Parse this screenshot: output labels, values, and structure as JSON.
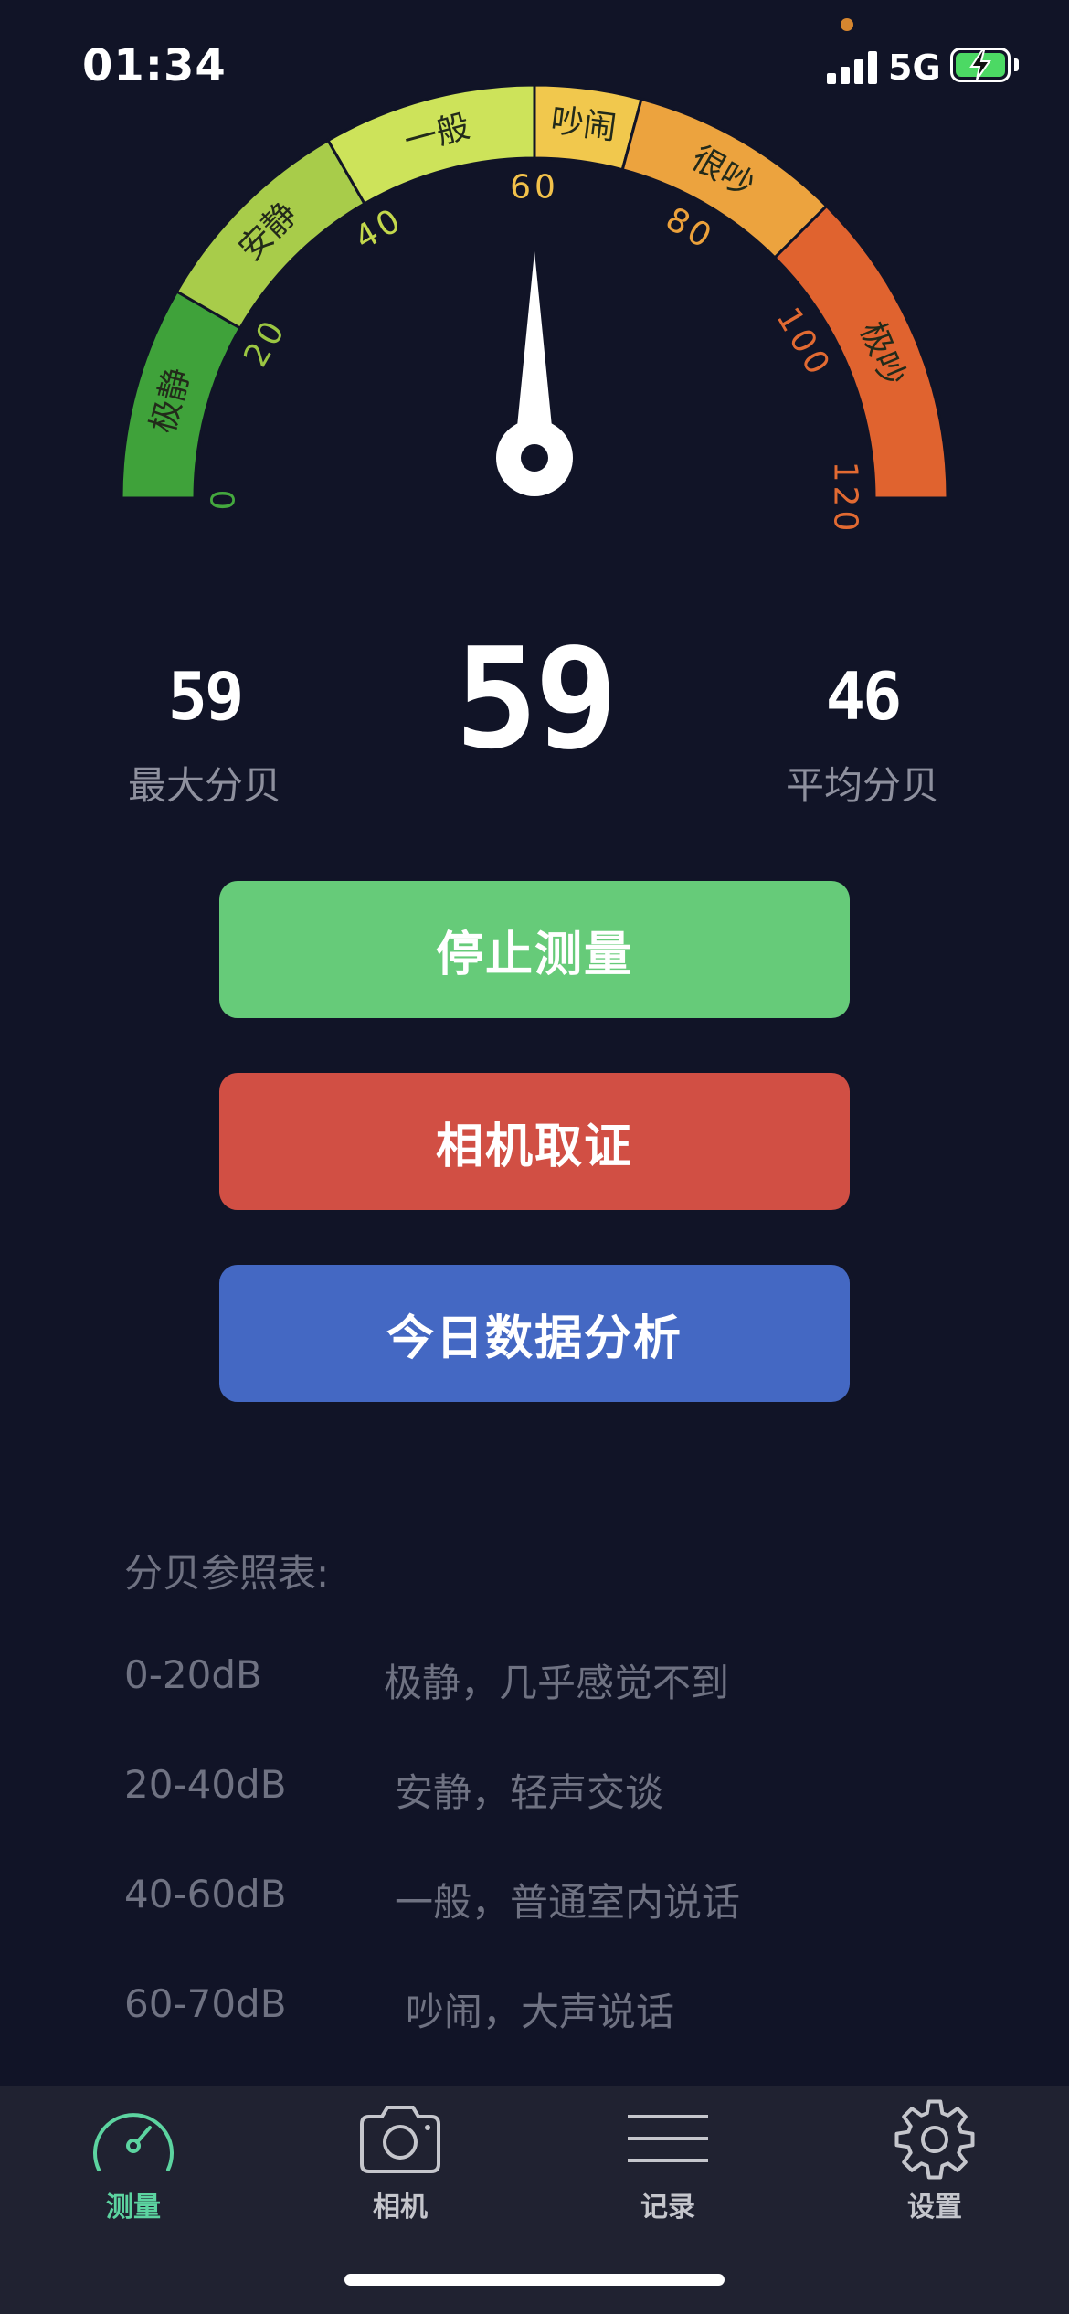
{
  "status_bar": {
    "time": "01:34",
    "network": "5G"
  },
  "gauge": {
    "min": 0,
    "max": 120,
    "needle_value": 60,
    "ticks": [
      "0",
      "20",
      "40",
      "60",
      "80",
      "100",
      "120"
    ],
    "zones": [
      {
        "label": "极静",
        "from": 0,
        "to": 20,
        "color": "#3fa23a"
      },
      {
        "label": "安静",
        "from": 20,
        "to": 40,
        "color": "#a8cc4a"
      },
      {
        "label": "一般",
        "from": 40,
        "to": 60,
        "color": "#cde35a"
      },
      {
        "label": "吵闹",
        "from": 60,
        "to": 70,
        "color": "#f1c84d"
      },
      {
        "label": "很吵",
        "from": 70,
        "to": 90,
        "color": "#eca33e"
      },
      {
        "label": "极吵",
        "from": 90,
        "to": 120,
        "color": "#e0632f"
      }
    ],
    "tick_colors": [
      "#44a83e",
      "#9bc642",
      "#c3d84c",
      "#f2c14a",
      "#eca13b",
      "#e26a32",
      "#e26a32"
    ]
  },
  "readings": {
    "current": "59",
    "max_value": "59",
    "max_label": "最大分贝",
    "avg_value": "46",
    "avg_label": "平均分贝"
  },
  "buttons": {
    "stop": "停止测量",
    "camera": "相机取证",
    "analysis": "今日数据分析"
  },
  "reference": {
    "title": "分贝参照表:",
    "rows": [
      {
        "range": "0-20dB",
        "desc": "极静，几乎感觉不到"
      },
      {
        "range": "20-40dB",
        "desc": "安静，轻声交谈"
      },
      {
        "range": "40-60dB",
        "desc": "一般，普通室内说话"
      },
      {
        "range": "60-70dB",
        "desc": "吵闹，大声说话"
      }
    ]
  },
  "tabs": [
    {
      "label": "测量",
      "icon": "gauge-icon",
      "active": true
    },
    {
      "label": "相机",
      "icon": "camera-icon",
      "active": false
    },
    {
      "label": "记录",
      "icon": "list-icon",
      "active": false
    },
    {
      "label": "设置",
      "icon": "gear-icon",
      "active": false
    }
  ],
  "colors": {
    "background": "#111427",
    "tabbar": "#202231",
    "active_tab": "#5cd4a0",
    "green_button": "#66cb79",
    "red_button": "#d14f44",
    "blue_button": "#4468c3"
  }
}
